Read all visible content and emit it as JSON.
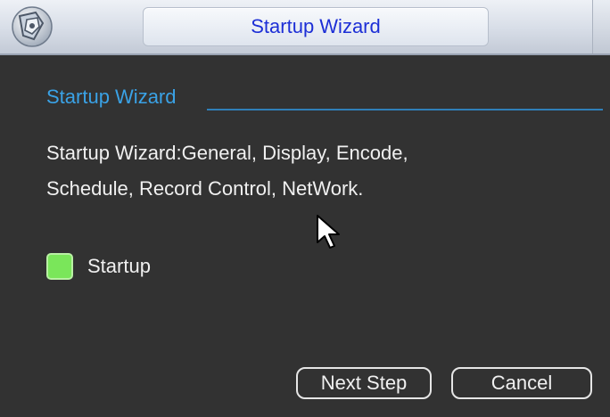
{
  "window": {
    "title": "Startup Wizard"
  },
  "section": {
    "title": "Startup Wizard"
  },
  "description": {
    "line1": "Startup Wizard:General, Display, Encode,",
    "line2": "Schedule, Record Control, NetWork."
  },
  "startup": {
    "label": "Startup",
    "checked": true
  },
  "buttons": {
    "next": "Next Step",
    "cancel": "Cancel"
  },
  "colors": {
    "title_text": "#1d2fd6",
    "section_title": "#3aa2e6",
    "checkbox": "#7ae65a",
    "background": "#323232"
  },
  "icons": {
    "app_logo": "app-logo-icon",
    "cursor": "mouse-pointer-icon"
  }
}
